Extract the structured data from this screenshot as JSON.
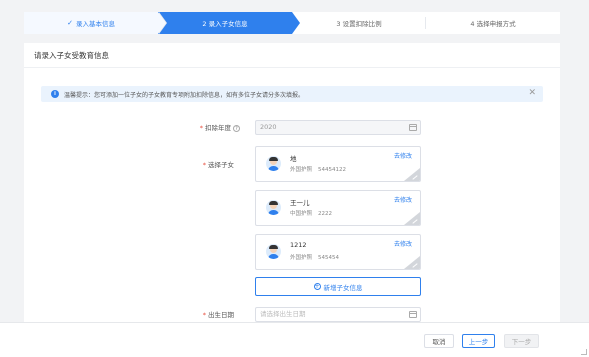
{
  "steps": [
    {
      "label": "录入基本信息",
      "check": "✓"
    },
    {
      "label": "2 录入子女信息"
    },
    {
      "label": "3 设置扣除比例"
    },
    {
      "label": "4 选择申报方式"
    }
  ],
  "panel": {
    "title": "请录入子女受教育信息",
    "tip": {
      "text": "温馨提示：您可添加一位子女的子女教育专项附加扣除信息，如有多位子女请分多次填报。",
      "close": "✕",
      "info": "i"
    },
    "year": {
      "label": "扣除年度",
      "required": "*",
      "help": "?",
      "value": "2020"
    },
    "children_label": {
      "label": "选择子女",
      "required": "*"
    },
    "children": [
      {
        "name": "地",
        "id_type": "外国护照",
        "id_no": "54454122",
        "edit": "去修改"
      },
      {
        "name": "王一儿",
        "id_type": "中国护照",
        "id_no": "2222",
        "edit": "去修改"
      },
      {
        "name": "1212",
        "id_type": "外国护照",
        "id_no": "545454",
        "edit": "去修改"
      }
    ],
    "add_child": {
      "icon": "+",
      "label": "新增子女信息"
    },
    "birth": {
      "label": "出生日期",
      "required": "*",
      "placeholder": "请选择出生日期"
    }
  },
  "footer": {
    "cancel": "取消",
    "prev": "上一步",
    "next": "下一步"
  },
  "colors": {
    "accent": "#2f80ed",
    "required": "#e74c3c"
  }
}
